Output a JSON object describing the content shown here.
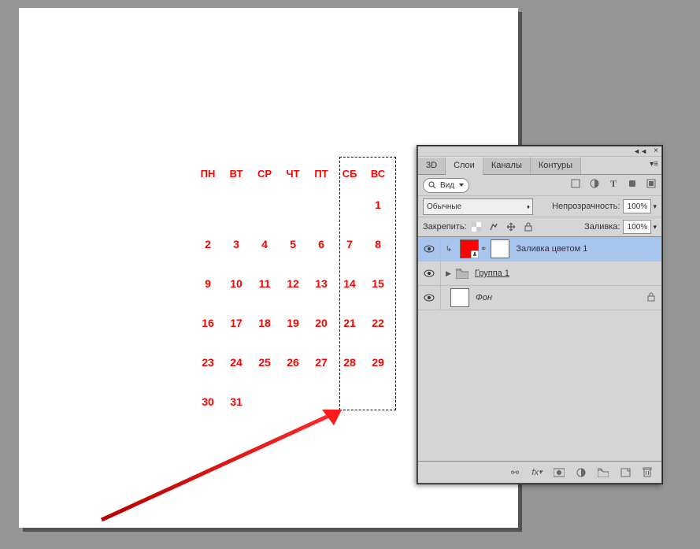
{
  "calendar": {
    "headers": [
      "ПН",
      "ВТ",
      "СР",
      "ЧТ",
      "ПТ",
      "СБ",
      "ВС"
    ],
    "rows": [
      [
        "",
        "",
        "",
        "",
        "",
        "",
        "1"
      ],
      [
        "2",
        "3",
        "4",
        "5",
        "6",
        "7",
        "8"
      ],
      [
        "9",
        "10",
        "11",
        "12",
        "13",
        "14",
        "15"
      ],
      [
        "16",
        "17",
        "18",
        "19",
        "20",
        "21",
        "22"
      ],
      [
        "23",
        "24",
        "25",
        "26",
        "27",
        "28",
        "29"
      ],
      [
        "30",
        "31",
        "",
        "",
        "",
        "",
        ""
      ]
    ]
  },
  "panel": {
    "tabs": {
      "t3d": "3D",
      "layers": "Слои",
      "channels": "Каналы",
      "paths": "Контуры"
    },
    "search": {
      "label": "Вид"
    },
    "blend": {
      "mode": "Обычные",
      "opacity_label": "Непрозрачность:",
      "opacity_value": "100%"
    },
    "lock": {
      "label": "Закрепить:",
      "fill_label": "Заливка:",
      "fill_value": "100%"
    },
    "layers": {
      "l1": "Заливка цветом 1",
      "l2": "Группа 1",
      "l3": "Фон"
    }
  }
}
